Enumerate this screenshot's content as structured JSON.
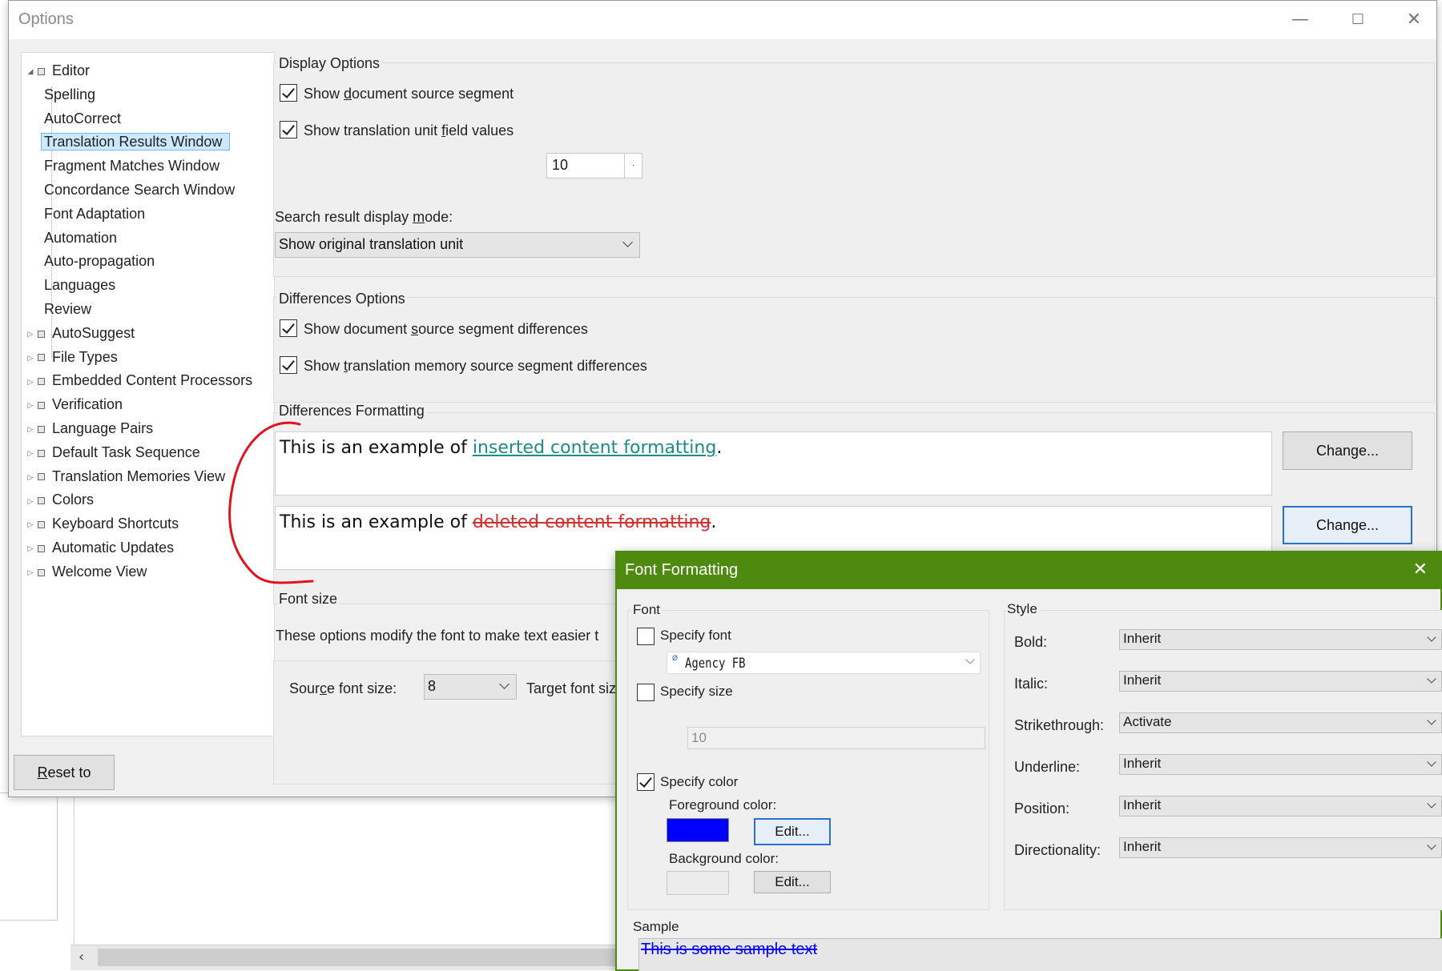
{
  "options_window": {
    "title": "Options",
    "minimize_glyph": "—",
    "maximize_glyph": "☐",
    "close_glyph": "✕",
    "tree": [
      {
        "label": "Editor",
        "expander": "◢",
        "icon": "pencil-icon"
      },
      {
        "label": "Spelling"
      },
      {
        "label": "AutoCorrect"
      },
      {
        "label": "Translation Results Window",
        "selected": true
      },
      {
        "label": "Fragment Matches Window"
      },
      {
        "label": "Concordance Search Window"
      },
      {
        "label": "Font Adaptation"
      },
      {
        "label": "Automation"
      },
      {
        "label": "Auto-propagation"
      },
      {
        "label": "Languages"
      },
      {
        "label": "Review"
      },
      {
        "label": "AutoSuggest",
        "expander": "▷",
        "icon": "autosuggest-icon"
      },
      {
        "label": "File Types",
        "expander": "▷",
        "icon": "file-types-icon"
      },
      {
        "label": "Embedded Content Processors",
        "expander": "▷",
        "icon": "embedded-icon"
      },
      {
        "label": "Verification",
        "expander": "▷",
        "icon": "verification-icon"
      },
      {
        "label": "Language Pairs",
        "expander": "▷",
        "icon": "language-pairs-icon"
      },
      {
        "label": "Default Task Sequence",
        "expander": "▷",
        "icon": "task-sequence-icon"
      },
      {
        "label": "Translation Memories View",
        "expander": "▷",
        "icon": "tm-view-icon"
      },
      {
        "label": "Colors",
        "expander": "▷",
        "icon": "colors-icon"
      },
      {
        "label": "Keyboard Shortcuts",
        "expander": "▷",
        "icon": "keyboard-icon"
      },
      {
        "label": "Automatic Updates",
        "expander": "▷",
        "icon": "updates-icon"
      },
      {
        "label": "Welcome View",
        "expander": "▷",
        "icon": "welcome-icon"
      }
    ],
    "display_options": {
      "title": "Display Options",
      "show_doc_source": {
        "pre": "Show ",
        "u": "d",
        "post": "ocument source segment",
        "checked": true
      },
      "show_tu_fields": {
        "pre": "Show translation unit ",
        "u": "f",
        "post": "ield values",
        "checked": true
      },
      "spin_value": "10",
      "search_mode_label": {
        "pre": "Search result display ",
        "u": "m",
        "post": "ode:"
      },
      "search_mode_value": "Show original translation unit"
    },
    "differences_options": {
      "title": "Differences Options",
      "doc_diff": {
        "pre": "Show document ",
        "u": "s",
        "post": "ource segment differences",
        "checked": true
      },
      "tm_diff": {
        "pre": "Show ",
        "u": "t",
        "post": "ranslation memory source segment differences",
        "checked": true
      }
    },
    "differences_formatting": {
      "title": "Differences Formatting",
      "inserted": {
        "prefix": "This is an example of ",
        "highlight": "inserted content formatting",
        "suffix": "."
      },
      "deleted": {
        "prefix": "This is an example of ",
        "highlight": "deleted content formatting",
        "suffix": "."
      },
      "change_button": "Change...",
      "inserted_color": "#1f8a8a",
      "deleted_color": "#d32f2f"
    },
    "font_size": {
      "title": "Font size",
      "description": "These options modify the font to make text easier t",
      "source_label": {
        "pre": "Sour",
        "u": "c",
        "post": "e font size:"
      },
      "source_value": "8",
      "target_label": "Target font size"
    },
    "reset_button": {
      "pre": "",
      "u": "R",
      "post": "eset to"
    }
  },
  "font_formatting": {
    "title": "Font Formatting",
    "close_glyph": "✕",
    "header_color": "#4f8a10",
    "font_group": "Font",
    "specify_font": {
      "label": "Specify font",
      "checked": false
    },
    "font_value": "Agency FB",
    "specify_size": {
      "label": "Specify size",
      "checked": false
    },
    "size_value": "10",
    "specify_color": {
      "label": "Specify color",
      "checked": true
    },
    "foreground_label": "Foreground color:",
    "foreground_color": "#0000ff",
    "background_label": "Background color:",
    "edit_button": "Edit...",
    "style_group": "Style",
    "styles": [
      {
        "label": "Bold:",
        "value": "Inherit"
      },
      {
        "label": "Italic:",
        "value": "Inherit"
      },
      {
        "label": "Strikethrough:",
        "value": "Activate"
      },
      {
        "label": "Underline:",
        "value": "Inherit"
      },
      {
        "label": "Position:",
        "value": "Inherit"
      },
      {
        "label": "Directionality:",
        "value": "Inherit"
      }
    ],
    "sample_label": "Sample",
    "sample_text": "This is some sample text"
  },
  "annotation": {
    "color": "#e0141e"
  }
}
